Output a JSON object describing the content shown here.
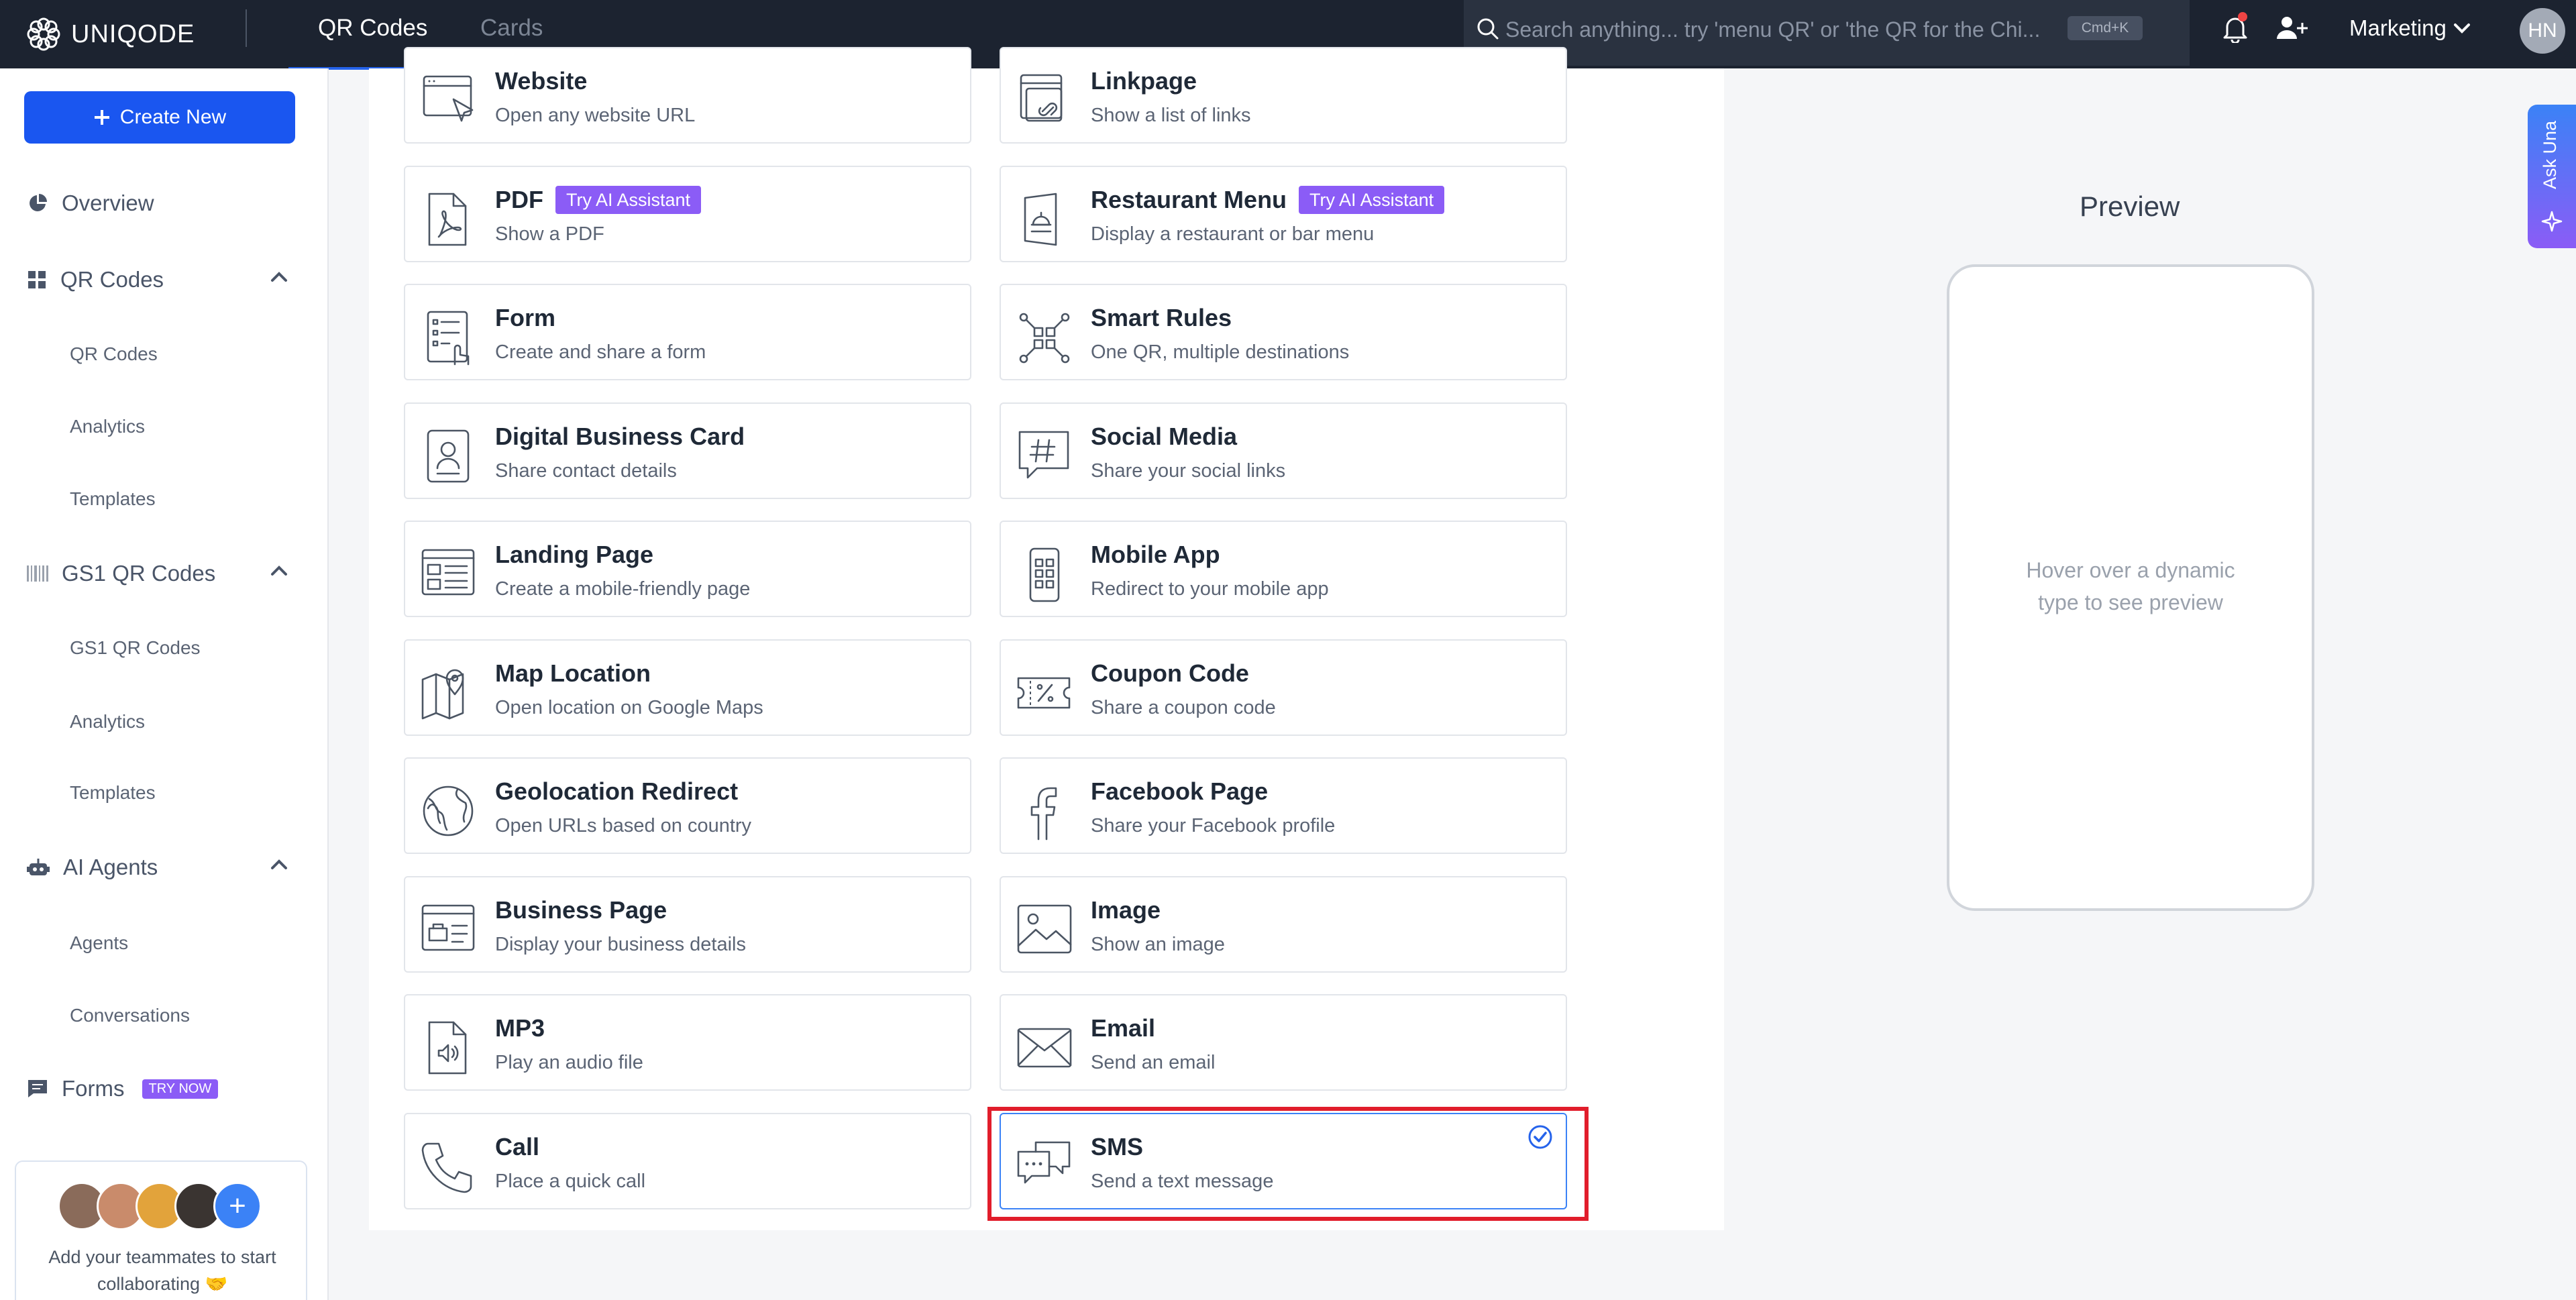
{
  "topbar": {
    "brand": "UNIQODE",
    "tabs": [
      {
        "label": "QR Codes",
        "active": true
      },
      {
        "label": "Cards",
        "active": false
      }
    ],
    "search_placeholder": "Search anything... try 'menu QR' or 'the QR for the Chi...",
    "search_shortcut": "Cmd+K",
    "workspace": "Marketing",
    "user_initials": "HN"
  },
  "sidebar": {
    "create_label": "Create New",
    "overview": "Overview",
    "qr_codes": {
      "label": "QR Codes",
      "items": [
        "QR Codes",
        "Analytics",
        "Templates"
      ]
    },
    "gs1": {
      "label": "GS1 QR Codes",
      "items": [
        "GS1 QR Codes",
        "Analytics",
        "Templates"
      ]
    },
    "ai_agents": {
      "label": "AI Agents",
      "items": [
        "Agents",
        "Conversations"
      ]
    },
    "forms": {
      "label": "Forms",
      "badge": "TRY NOW"
    },
    "team_card": {
      "text": "Add your teammates to start collaborating 🤝",
      "add_symbol": "+"
    }
  },
  "types": [
    {
      "title": "Website",
      "desc": "Open any website URL",
      "icon": "website-icon"
    },
    {
      "title": "Linkpage",
      "desc": "Show a list of links",
      "icon": "linkpage-icon"
    },
    {
      "title": "PDF",
      "desc": "Show a PDF",
      "icon": "pdf-icon",
      "badge": "Try AI Assistant"
    },
    {
      "title": "Restaurant Menu",
      "desc": "Display a restaurant or bar menu",
      "icon": "restaurant-menu-icon",
      "badge": "Try AI Assistant"
    },
    {
      "title": "Form",
      "desc": "Create and share a form",
      "icon": "form-icon"
    },
    {
      "title": "Smart Rules",
      "desc": "One QR, multiple destinations",
      "icon": "smart-rules-icon"
    },
    {
      "title": "Digital Business Card",
      "desc": "Share contact details",
      "icon": "business-card-icon"
    },
    {
      "title": "Social Media",
      "desc": "Share your social links",
      "icon": "social-media-icon"
    },
    {
      "title": "Landing Page",
      "desc": "Create a mobile-friendly page",
      "icon": "landing-page-icon"
    },
    {
      "title": "Mobile App",
      "desc": "Redirect to your mobile app",
      "icon": "mobile-app-icon"
    },
    {
      "title": "Map Location",
      "desc": "Open location on Google Maps",
      "icon": "map-location-icon"
    },
    {
      "title": "Coupon Code",
      "desc": "Share a coupon code",
      "icon": "coupon-icon"
    },
    {
      "title": "Geolocation Redirect",
      "desc": "Open URLs based on country",
      "icon": "globe-icon"
    },
    {
      "title": "Facebook Page",
      "desc": "Share your Facebook profile",
      "icon": "facebook-icon"
    },
    {
      "title": "Business Page",
      "desc": "Display your business details",
      "icon": "business-page-icon"
    },
    {
      "title": "Image",
      "desc": "Show an image",
      "icon": "image-icon"
    },
    {
      "title": "MP3",
      "desc": "Play an audio file",
      "icon": "mp3-icon"
    },
    {
      "title": "Email",
      "desc": "Send an email",
      "icon": "email-icon"
    },
    {
      "title": "Call",
      "desc": "Place a quick call",
      "icon": "call-icon"
    },
    {
      "title": "SMS",
      "desc": "Send a text message",
      "icon": "sms-icon",
      "selected": true
    }
  ],
  "preview": {
    "title": "Preview",
    "hint": "Hover over a dynamic type to see preview"
  },
  "ask_una": "Ask Una",
  "colors": {
    "accent": "#1a56f0",
    "badge": "#8b5cf6",
    "selection_outline": "#e11d2b",
    "topbar": "#1c2330"
  }
}
